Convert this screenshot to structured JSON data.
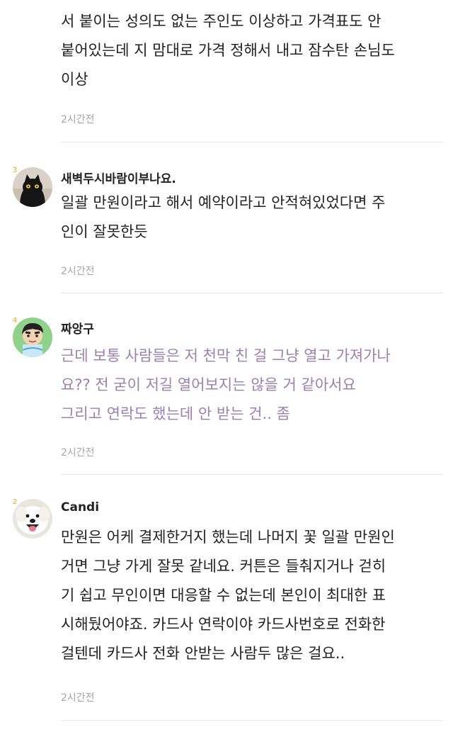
{
  "comments": [
    {
      "nickname": "",
      "avatar": "none",
      "lines": [
        "서 붙이는 성의도 없는 주인도 이상하고 가격표도 안",
        "붙어있는데 지 맘대로 가격 정해서 내고 잠수탄 손님도",
        "이상"
      ],
      "time": "2시간전"
    },
    {
      "nickname": "새벽두시바람이부나요.",
      "avatar": "black-cat-avatar",
      "level": "3",
      "lines": [
        "일괄 만원이라고 해서 예약이라고 안적혀있었다면 주",
        "인이 잘못한듯"
      ],
      "time": "2시간전"
    },
    {
      "nickname": "짜앙구",
      "avatar": "cartoon-boy-avatar",
      "level": "4",
      "lines": [
        "근데 보통 사람들은 저 천막 친 걸 그냥 열고 가져가나",
        "요?? 전 굳이 저길 열어보지는 않을 거 같아서요",
        "그리고 연락도 했는데 안 받는 건.. 좀"
      ],
      "text_color": "#9b7fb6",
      "time": "2시간전"
    },
    {
      "nickname": "Candi",
      "avatar": "white-dog-avatar",
      "level": "2",
      "lines": [
        "만원은 어케 결제한거지 했는데 나머지 꽃 일괄 만원인",
        "거면 그냥 가게 잘못 같네요. 커튼은 들춰지거나 걷히",
        "기 쉽고 무인이면 대응할 수 없는데 본인이 최대한 표",
        "시해뒀어야죠. 카드사 연락이야 카드사번호로 전화한",
        "걸텐데 카드사 전화 안받는 사람두 많은 걸요.."
      ],
      "time": "2시간전"
    }
  ]
}
